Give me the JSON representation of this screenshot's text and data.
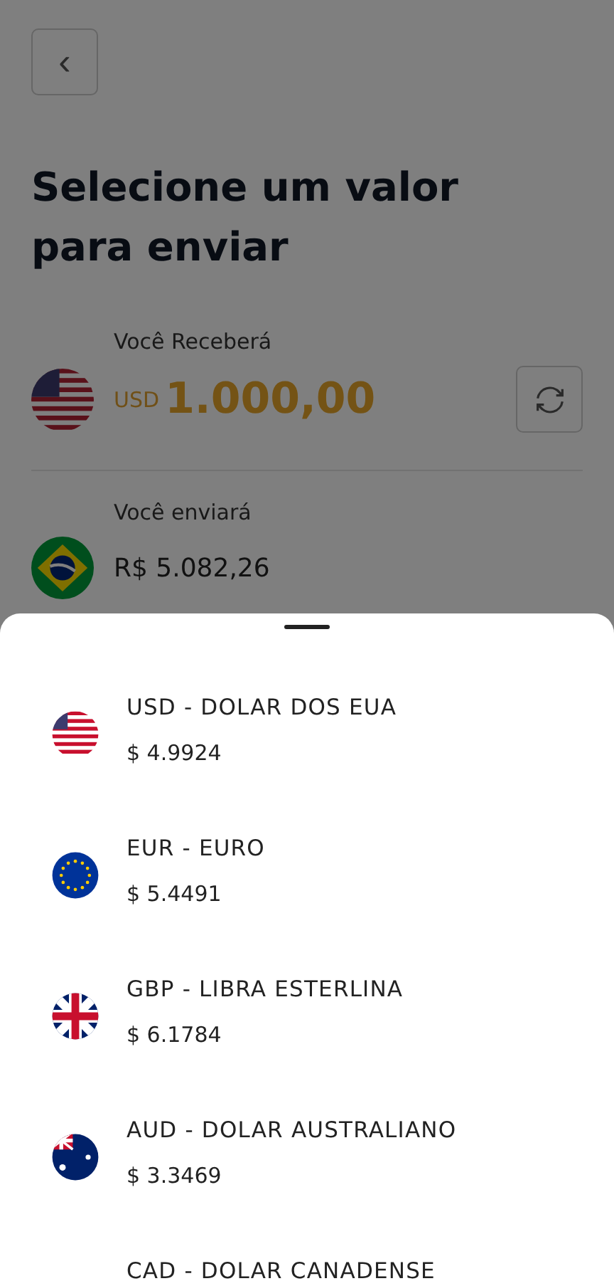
{
  "header": {
    "back_icon": "‹",
    "title": "Selecione um valor para enviar"
  },
  "receive": {
    "label": "Você Receberá",
    "kind": "us_flag",
    "currency": "USD",
    "amount": "1.000,00"
  },
  "send": {
    "label": "Você enviará",
    "kind": "br_flag",
    "currency": "R$",
    "amount": "5.082,26"
  },
  "sheet": {
    "currencies": [
      {
        "kind": "us_flag",
        "name": "USD - DOLAR DOS EUA",
        "rate": "$ 4.9924"
      },
      {
        "kind": "eu_flag",
        "name": "EUR - EURO",
        "rate": "$ 5.4491"
      },
      {
        "kind": "gb_flag",
        "name": "GBP - LIBRA ESTERLINA",
        "rate": "$ 6.1784"
      },
      {
        "kind": "au_flag",
        "name": "AUD - DOLAR AUSTRALIANO",
        "rate": "$ 3.3469"
      },
      {
        "kind": "text_only",
        "name": "CAD - DOLAR CANADENSE"
      }
    ]
  }
}
